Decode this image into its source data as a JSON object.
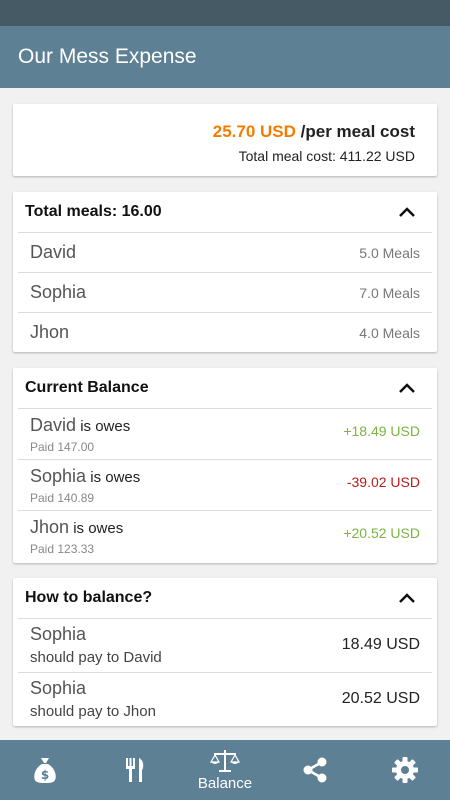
{
  "app": {
    "title": "Our Mess Expense"
  },
  "summary": {
    "per_meal_amount": "25.70 USD",
    "per_meal_suffix": " /per meal cost",
    "total_meal_cost": "Total meal cost: 411.22 USD"
  },
  "meals": {
    "header": "Total meals: 16.00",
    "rows": [
      {
        "name": "David",
        "count": "5.0 Meals"
      },
      {
        "name": "Sophia",
        "count": "7.0 Meals"
      },
      {
        "name": "Jhon",
        "count": "4.0 Meals"
      }
    ]
  },
  "balance": {
    "header": "Current Balance",
    "rows": [
      {
        "name": "David",
        "owes": " is owes",
        "paid": "Paid 147.00",
        "amount": "+18.49 USD",
        "status": "positive"
      },
      {
        "name": "Sophia",
        "owes": " is owes",
        "paid": "Paid 140.89",
        "amount": "-39.02 USD",
        "status": "negative"
      },
      {
        "name": "Jhon",
        "owes": " is owes",
        "paid": "Paid 123.33",
        "amount": "+20.52 USD",
        "status": "positive"
      }
    ]
  },
  "howto": {
    "header": "How to balance?",
    "rows": [
      {
        "name": "Sophia",
        "to": "should pay to David",
        "amount": "18.49 USD"
      },
      {
        "name": "Sophia",
        "to": "should pay to Jhon",
        "amount": "20.52 USD"
      }
    ]
  },
  "nav": {
    "items": [
      {
        "icon": "money-bag-icon",
        "label": ""
      },
      {
        "icon": "fork-knife-icon",
        "label": ""
      },
      {
        "icon": "balance-scale-icon",
        "label": "Balance"
      },
      {
        "icon": "share-icon",
        "label": ""
      },
      {
        "icon": "gear-icon",
        "label": ""
      }
    ]
  },
  "colors": {
    "primary": "#5d8094",
    "status_bar": "#455a64",
    "accent_orange": "#f57c00",
    "positive": "#7cb342",
    "negative": "#b71c1c"
  }
}
